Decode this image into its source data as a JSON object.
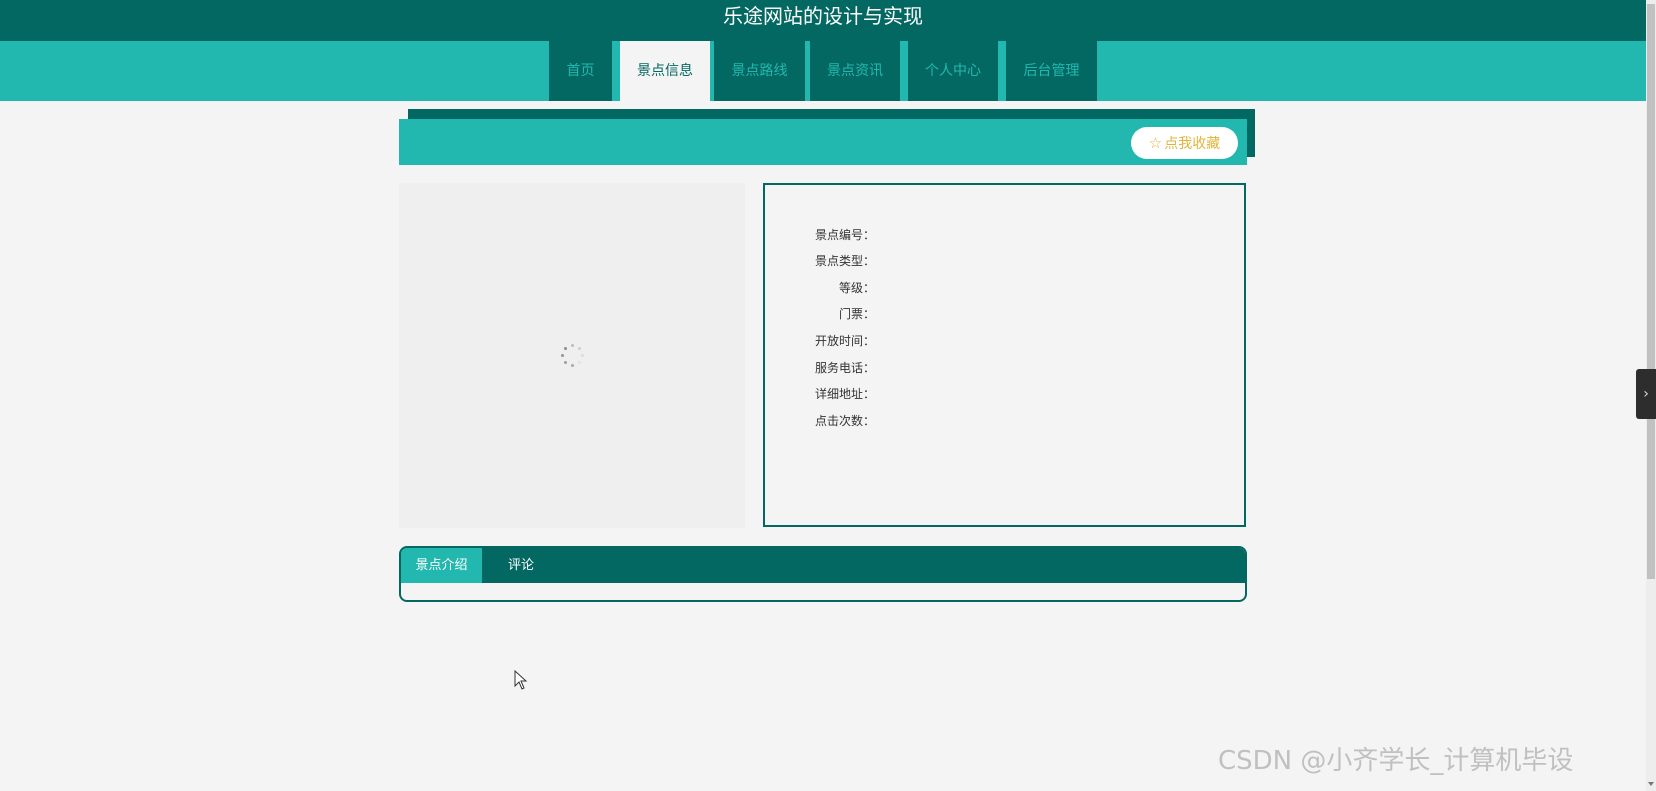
{
  "header": {
    "title": "乐途网站的设计与实现"
  },
  "nav": {
    "items": [
      {
        "label": "首页",
        "active": false
      },
      {
        "label": "景点信息",
        "active": true
      },
      {
        "label": "景点路线",
        "active": false
      },
      {
        "label": "景点资讯",
        "active": false
      },
      {
        "label": "个人中心",
        "active": false
      },
      {
        "label": "后台管理",
        "active": false
      }
    ]
  },
  "favorite": {
    "label": "点我收藏",
    "icon": "star-outline-icon"
  },
  "details": {
    "fields": [
      {
        "label": "景点编号："
      },
      {
        "label": "景点类型："
      },
      {
        "label": "等级："
      },
      {
        "label": "门票："
      },
      {
        "label": "开放时间："
      },
      {
        "label": "服务电话："
      },
      {
        "label": "详细地址："
      },
      {
        "label": "点击次数："
      }
    ]
  },
  "tabs": [
    {
      "label": "景点介绍",
      "active": true
    },
    {
      "label": "评论",
      "active": false
    }
  ],
  "side_toggle": {
    "icon": "chevron-right-icon",
    "glyph": "›"
  },
  "watermark": {
    "text": "CSDN @小齐学长_计算机毕设"
  },
  "colors": {
    "primary_dark": "#046862",
    "primary_light": "#22b8b0",
    "accent_gold": "#e0b53c",
    "background": "#f4f4f4"
  }
}
